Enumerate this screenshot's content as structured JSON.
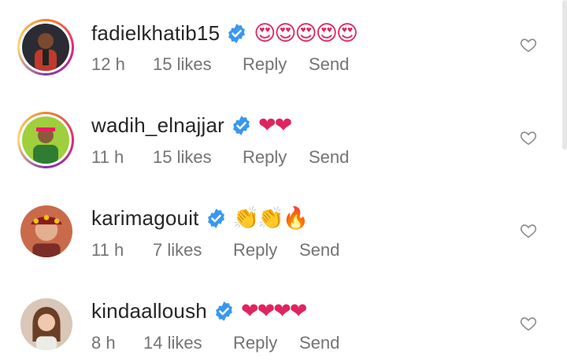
{
  "comments": [
    {
      "username": "fadielkhatib15",
      "emojis": "😍😍😍😍😍",
      "time": "12 h",
      "likes": "15 likes",
      "reply": "Reply",
      "send": "Send",
      "story_ring": true
    },
    {
      "username": "wadih_elnajjar",
      "emojis": "❤❤",
      "time": "11 h",
      "likes": "15 likes",
      "reply": "Reply",
      "send": "Send",
      "story_ring": true
    },
    {
      "username": "karimagouit",
      "emojis": "👏👏🔥",
      "time": "11 h",
      "likes": "7 likes",
      "reply": "Reply",
      "send": "Send",
      "story_ring": false
    },
    {
      "username": "kindaalloush",
      "emojis": "❤❤❤❤",
      "time": "8 h",
      "likes": "14 likes",
      "reply": "Reply",
      "send": "Send",
      "story_ring": false
    }
  ],
  "colors": {
    "username": "#262626",
    "meta": "#737373",
    "verified": "#3897f0",
    "heart": "#8e8e8e"
  }
}
